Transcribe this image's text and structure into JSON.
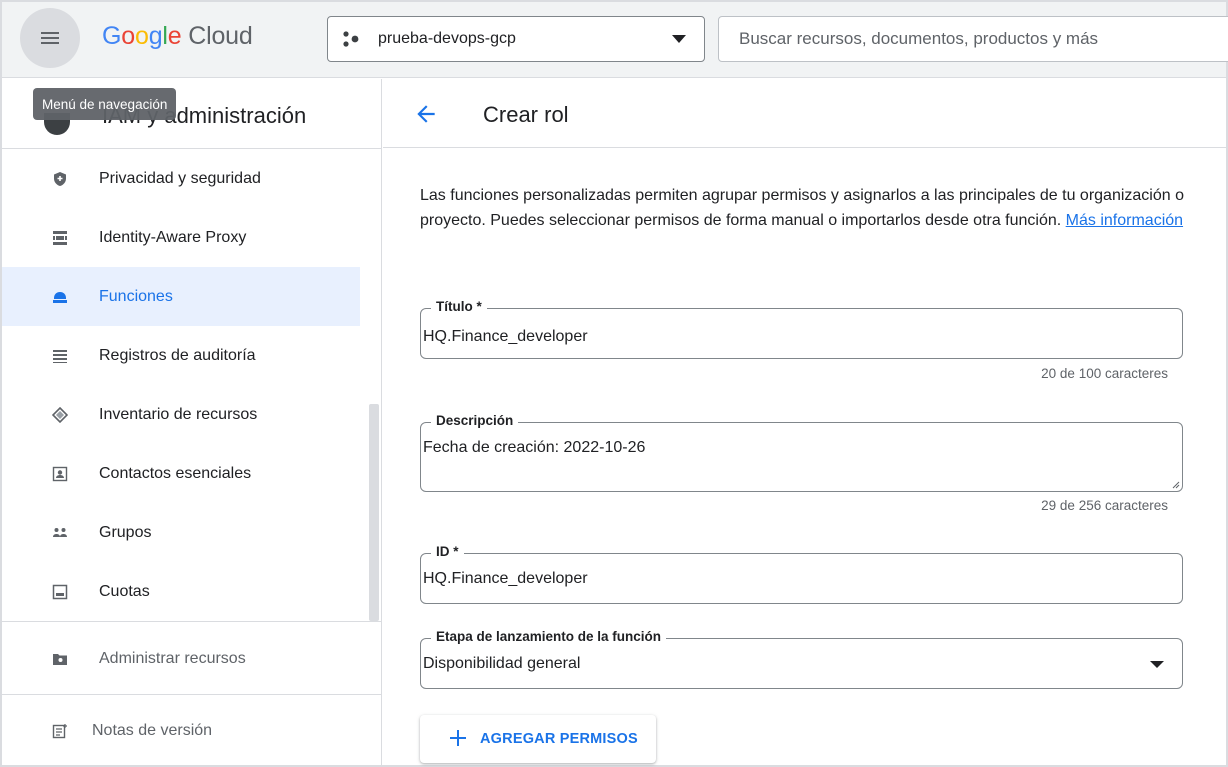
{
  "topbar": {
    "menu_tooltip": "Menú de navegación",
    "brand_google": "Google",
    "brand_cloud": "Cloud",
    "project": "prueba-devops-gcp",
    "search_placeholder": "Buscar recursos, documentos, productos y más"
  },
  "sidebar": {
    "title": "IAM y administración",
    "items": [
      {
        "label": "Privacidad y seguridad",
        "icon": "shield-icon"
      },
      {
        "label": "Identity-Aware Proxy",
        "icon": "proxy-icon"
      },
      {
        "label": "Funciones",
        "icon": "roles-icon",
        "active": true
      },
      {
        "label": "Registros de auditoría",
        "icon": "audit-log-icon"
      },
      {
        "label": "Inventario de recursos",
        "icon": "asset-inventory-icon"
      },
      {
        "label": "Contactos esenciales",
        "icon": "contacts-icon"
      },
      {
        "label": "Grupos",
        "icon": "groups-icon"
      },
      {
        "label": "Cuotas",
        "icon": "quotas-icon"
      }
    ],
    "manage_resources": "Administrar recursos",
    "release_notes": "Notas de versión"
  },
  "main": {
    "title": "Crear rol",
    "intro_text": "Las funciones personalizadas permiten agrupar permisos y asignarlos a las principales de tu organización o proyecto. Puedes seleccionar permisos de forma manual o importarlos desde otra función.",
    "intro_link": "Más información",
    "fields": {
      "title": {
        "label": "Título *",
        "value": "HQ.Finance_developer",
        "counter": "20 de 100 caracteres"
      },
      "description": {
        "label": "Descripción",
        "value": "Fecha de creación: 2022-10-26",
        "counter": "29 de 256 caracteres"
      },
      "id": {
        "label": "ID *",
        "value": "HQ.Finance_developer"
      },
      "stage": {
        "label": "Etapa de lanzamiento de la función",
        "value": "Disponibilidad general"
      }
    },
    "add_permissions": "AGREGAR PERMISOS"
  },
  "colors": {
    "accent": "#1a73e8",
    "active_bg": "#e8f0fe",
    "topbar_bg": "#f1f3f4"
  }
}
